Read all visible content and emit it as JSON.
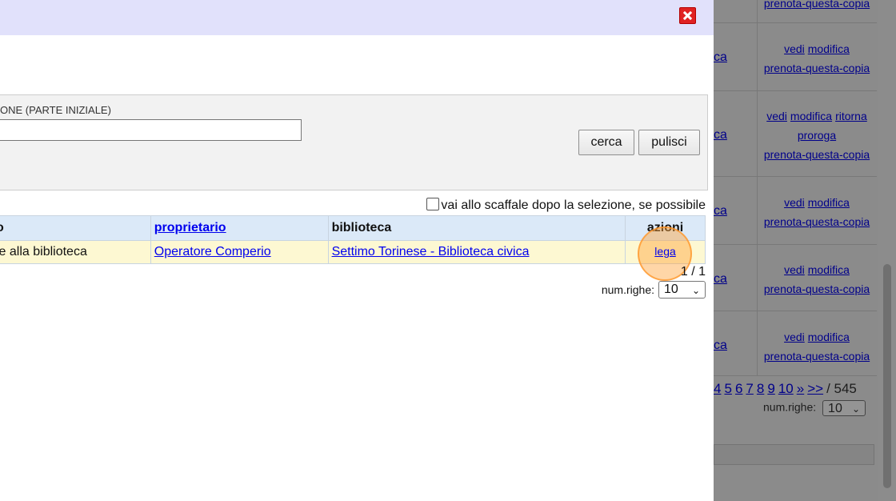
{
  "background": {
    "rows": [
      {
        "col_link": "",
        "actions": [
          "prenota-questa-copia"
        ]
      },
      {
        "col_link": "ca",
        "actions": [
          "vedi",
          "modifica",
          "prenota-questa-copia"
        ]
      },
      {
        "col_link": "ca",
        "actions": [
          "vedi",
          "modifica",
          "ritorna",
          "proroga",
          "prenota-questa-copia"
        ]
      },
      {
        "col_link": "ca",
        "actions": [
          "vedi",
          "modifica",
          "prenota-questa-copia"
        ]
      },
      {
        "col_link": "ca",
        "actions": [
          "vedi",
          "modifica",
          "prenota-questa-copia"
        ]
      },
      {
        "col_link": "ca",
        "actions": [
          "vedi",
          "modifica",
          "prenota-questa-copia"
        ]
      }
    ],
    "pager": {
      "pages": [
        "4",
        "5",
        "6",
        "7",
        "8",
        "9",
        "10",
        "»",
        ">>"
      ],
      "total": "/ 545"
    },
    "numrighe_label": "num.righe:",
    "numrighe_value": "10"
  },
  "dialog": {
    "search_label": "ONE (PARTE INIZIALE)",
    "search_value": "",
    "cerca_label": "cerca",
    "pulisci_label": "pulisci",
    "checkbox_label": "vai allo scaffale dopo la selezione, se possibile",
    "table": {
      "headers": [
        "o",
        "proprietario",
        "biblioteca",
        "azioni"
      ],
      "rows": [
        {
          "col0": "le alla biblioteca",
          "proprietario": "Operatore Comperio",
          "biblioteca": "Settimo Torinese - Biblioteca civica",
          "azione": "lega"
        }
      ]
    },
    "pageinfo": "1 / 1",
    "numrighe_label": "num.righe:",
    "numrighe_value": "10"
  },
  "colors": {
    "header_bg": "#e1e1fb",
    "row_bg": "#fdf8d2",
    "th_bg": "#dbe9f8",
    "link": "#0000ee",
    "close": "#e02222"
  }
}
